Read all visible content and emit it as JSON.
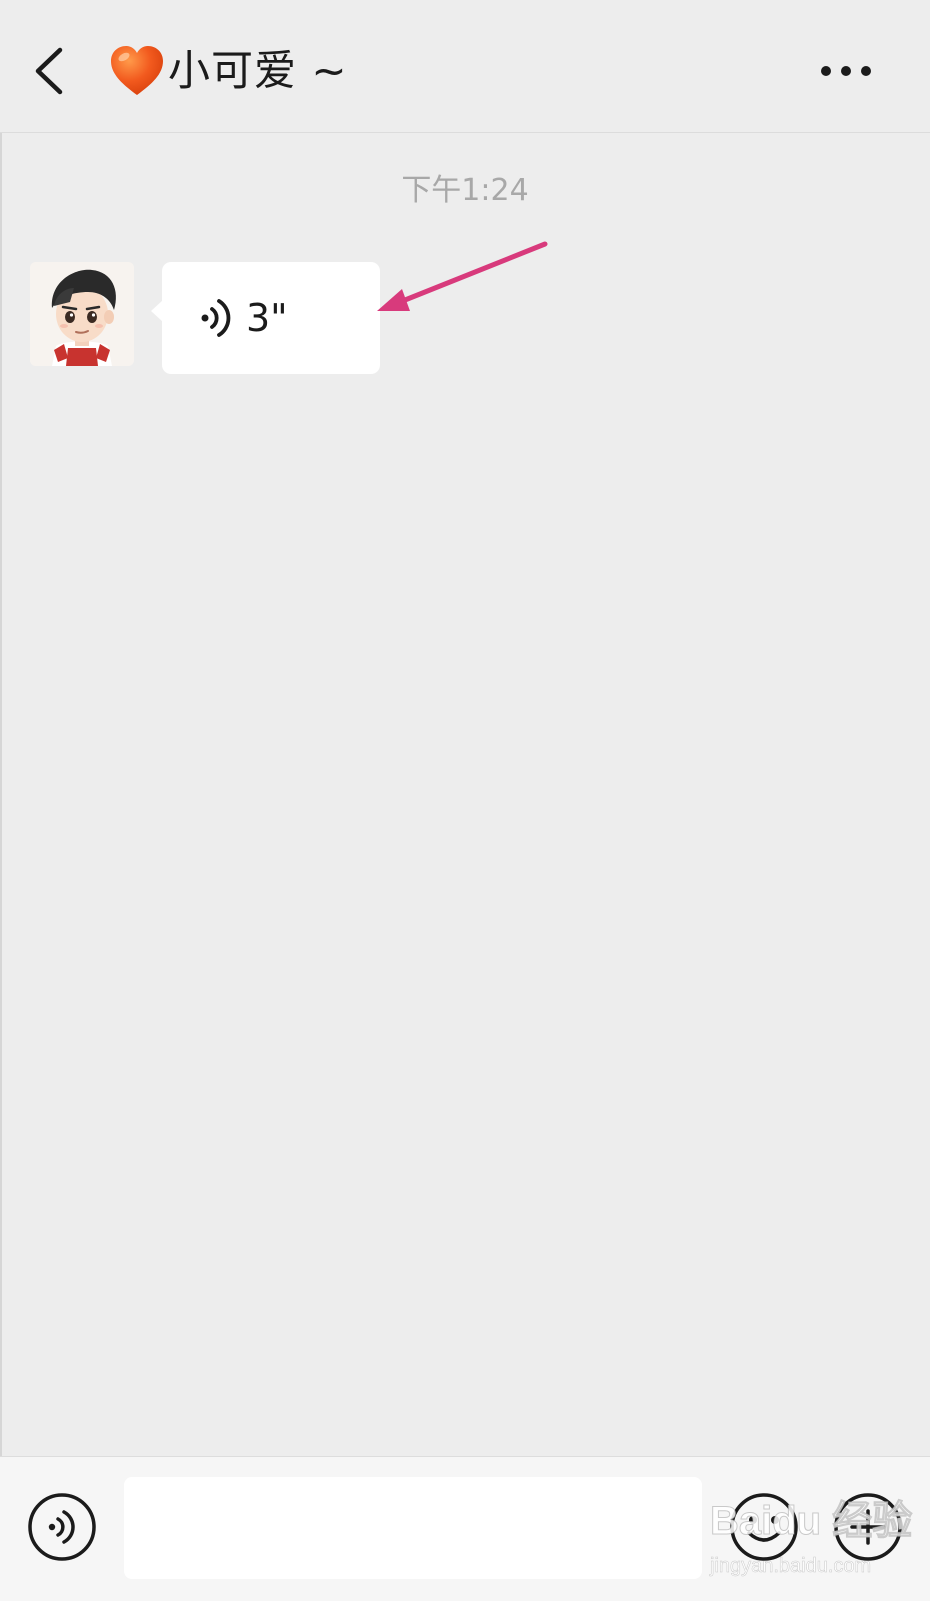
{
  "header": {
    "title": "小可爱 ~",
    "back_icon": "chevron-left-icon",
    "title_emoji_icon": "orange-heart-icon",
    "more_icon": "more-dots-icon"
  },
  "chat": {
    "timestamp": "下午1:24",
    "messages": [
      {
        "sender": "contact",
        "type": "voice",
        "duration": "3\"",
        "avatar_icon": "cartoon-boy-avatar"
      }
    ],
    "annotation": {
      "type": "arrow",
      "color": "#d83a7c",
      "points_to": "voice-message-bubble"
    }
  },
  "input_bar": {
    "voice_toggle_icon": "voice-mode-icon",
    "text_value": "",
    "emoji_icon": "emoji-face-icon",
    "plus_icon": "plus-circle-icon"
  },
  "watermark": {
    "logo_text": "Baidu 经验",
    "url": "jingyan.baidu.com"
  },
  "colors": {
    "background": "#ededed",
    "bubble": "#ffffff",
    "heart": "#f25a1e",
    "arrow": "#d83a7c",
    "timestamp": "#a8a8a8"
  }
}
